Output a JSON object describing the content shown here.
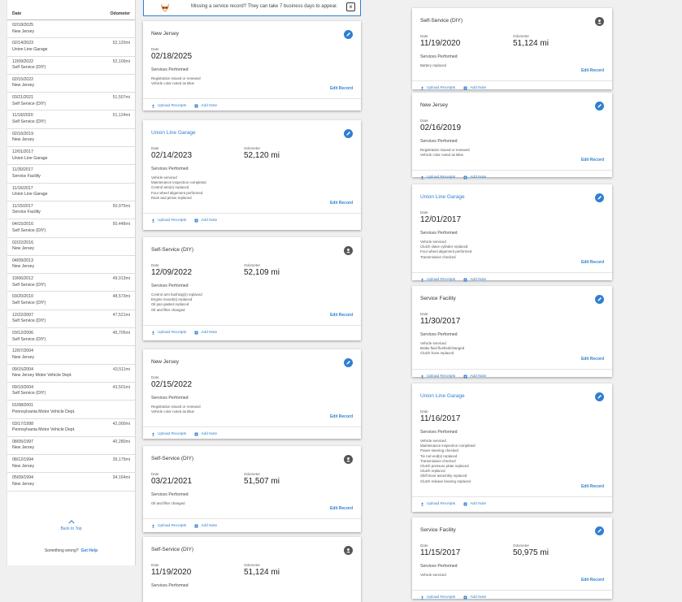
{
  "banner": {
    "message": "Missing a service record? They can take 7 business days to appear."
  },
  "table": {
    "header_date": "Date",
    "header_odometer": "Odometer",
    "rows": [
      {
        "date": "02/18/2025",
        "source": "New Jersey",
        "odometer": ""
      },
      {
        "date": "02/14/2023",
        "source": "Union Line Garage",
        "odometer": "52,120mi"
      },
      {
        "date": "12/09/2022",
        "source": "Self Service (DIY)",
        "odometer": "52,109mi"
      },
      {
        "date": "02/15/2022",
        "source": "New Jersey",
        "odometer": ""
      },
      {
        "date": "03/21/2021",
        "source": "Self Service (DIY)",
        "odometer": "51,507mi"
      },
      {
        "date": "11/19/2020",
        "source": "Self Service (DIY)",
        "odometer": "51,124mi"
      },
      {
        "date": "02/16/2019",
        "source": "New Jersey",
        "odometer": ""
      },
      {
        "date": "12/01/2017",
        "source": "Union Line Garage",
        "odometer": ""
      },
      {
        "date": "11/30/2017",
        "source": "Service Facility",
        "odometer": ""
      },
      {
        "date": "11/16/2017",
        "source": "Union Line Garage",
        "odometer": ""
      },
      {
        "date": "11/15/2017",
        "source": "Service Facility",
        "odometer": "50,975mi"
      },
      {
        "date": "04/15/2016",
        "source": "Self Service (DIY)",
        "odometer": "50,448mi"
      },
      {
        "date": "02/22/2016",
        "source": "New Jersey",
        "odometer": ""
      },
      {
        "date": "04/09/2013",
        "source": "New Jersey",
        "odometer": ""
      },
      {
        "date": "10/06/2012",
        "source": "Self Service (DIY)",
        "odometer": "49,913mi"
      },
      {
        "date": "03/20/2010",
        "source": "Self Service (DIY)",
        "odometer": "48,573mi"
      },
      {
        "date": "12/22/2007",
        "source": "Self Service (DIY)",
        "odometer": "47,521mi"
      },
      {
        "date": "03/12/2006",
        "source": "Self Service (DIY)",
        "odometer": "45,705mi"
      },
      {
        "date": "12/07/2004",
        "source": "New Jersey",
        "odometer": ""
      },
      {
        "date": "09/15/2004",
        "source": "New Jersey Motor Vehicle Dept.",
        "odometer": "43,511mi"
      },
      {
        "date": "09/10/2004",
        "source": "Self Service (DIY)",
        "odometer": "43,501mi"
      },
      {
        "date": "01/08/2001",
        "source": "Pennsylvania Motor Vehicle Dept.",
        "odometer": ""
      },
      {
        "date": "03/17/1998",
        "source": "Pennsylvania Motor Vehicle Dept.",
        "odometer": "42,000mi"
      },
      {
        "date": "08/05/1997",
        "source": "New Jersey",
        "odometer": "40,280mi"
      },
      {
        "date": "08/12/1994",
        "source": "New Jersey",
        "odometer": "39,179mi"
      },
      {
        "date": "05/09/1994",
        "source": "New Jersey",
        "odometer": "34,164mi"
      }
    ],
    "back_to_top": "Back to Top",
    "something_wrong": "Something wrong?",
    "get_help": "Get Help"
  },
  "labels": {
    "date": "Date",
    "odometer": "Odometer",
    "services_performed": "Services Performed",
    "edit_record": "Edit Record",
    "upload_receipts": "Upload Receipts",
    "add_note": "Add Note"
  },
  "cards": [
    {
      "name": "New Jersey",
      "name_link": false,
      "icon": "pencil-icon",
      "date": "02/18/2025",
      "odometer": "",
      "services": [
        "Registration issued or renewed",
        "Vehicle color noted as Blue"
      ]
    },
    {
      "name": "Union Line Garage",
      "name_link": true,
      "icon": "pencil-icon",
      "date": "02/14/2023",
      "odometer": "52,120 mi",
      "services": [
        "Vehicle serviced",
        "Maintenance inspection completed",
        "Control arm(s) replaced",
        "Four wheel alignment performed",
        "Rack and pinion replaced"
      ]
    },
    {
      "name": "Self-Service (DIY)",
      "name_link": false,
      "icon": "user-icon",
      "date": "12/09/2022",
      "odometer": "52,109 mi",
      "services": [
        "Control arm bushing(s) replaced",
        "Engine mount(s) replaced",
        "Oil pan gasket replaced",
        "Oil and filter changed"
      ]
    },
    {
      "name": "New Jersey",
      "name_link": false,
      "icon": "pencil-icon",
      "date": "02/15/2022",
      "odometer": "",
      "services": [
        "Registration issued or renewed",
        "Vehicle color noted as Blue"
      ]
    },
    {
      "name": "Self-Service (DIY)",
      "name_link": false,
      "icon": "user-icon",
      "date": "03/21/2021",
      "odometer": "51,507 mi",
      "services": [
        "Oil and filter changed"
      ]
    },
    {
      "name": "Self-Service (DIY)",
      "name_link": false,
      "icon": "user-icon",
      "date": "11/19/2020",
      "odometer": "51,124 mi",
      "services": []
    },
    {
      "name": "Self-Service (DIY)",
      "name_link": false,
      "icon": "user-icon",
      "date": "11/19/2020",
      "odometer": "51,124 mi",
      "services": [
        "Battery replaced"
      ]
    },
    {
      "name": "New Jersey",
      "name_link": false,
      "icon": "pencil-icon",
      "date": "02/16/2019",
      "odometer": "",
      "services": [
        "Registration issued or renewed",
        "Vehicle color noted as Blue"
      ]
    },
    {
      "name": "Union Line Garage",
      "name_link": true,
      "icon": "pencil-icon",
      "date": "12/01/2017",
      "odometer": "",
      "services": [
        "Vehicle serviced",
        "Clutch slave cylinder replaced",
        "Four wheel alignment performed",
        "Transmission checked"
      ]
    },
    {
      "name": "Service Facility",
      "name_link": false,
      "icon": "pencil-icon",
      "date": "11/30/2017",
      "odometer": "",
      "services": [
        "Vehicle serviced",
        "Brake fluid flushed/changed",
        "Clutch hose replaced"
      ]
    },
    {
      "name": "Union Line Garage",
      "name_link": true,
      "icon": "pencil-icon",
      "date": "11/16/2017",
      "odometer": "",
      "services": [
        "Vehicle serviced",
        "Maintenance inspection completed",
        "Power steering checked",
        "Tie rod end(s) replaced",
        "Transmission checked",
        "Clutch pressure plate replaced",
        "Clutch replaced",
        "Shift lever assembly replaced",
        "Clutch release bearing replaced"
      ]
    },
    {
      "name": "Service Facility",
      "name_link": false,
      "icon": "pencil-icon",
      "date": "11/15/2017",
      "odometer": "50,975 mi",
      "services": [
        "Vehicle serviced"
      ]
    }
  ],
  "colors": {
    "accent": "#2f7fd1",
    "user_icon": "#555555"
  }
}
